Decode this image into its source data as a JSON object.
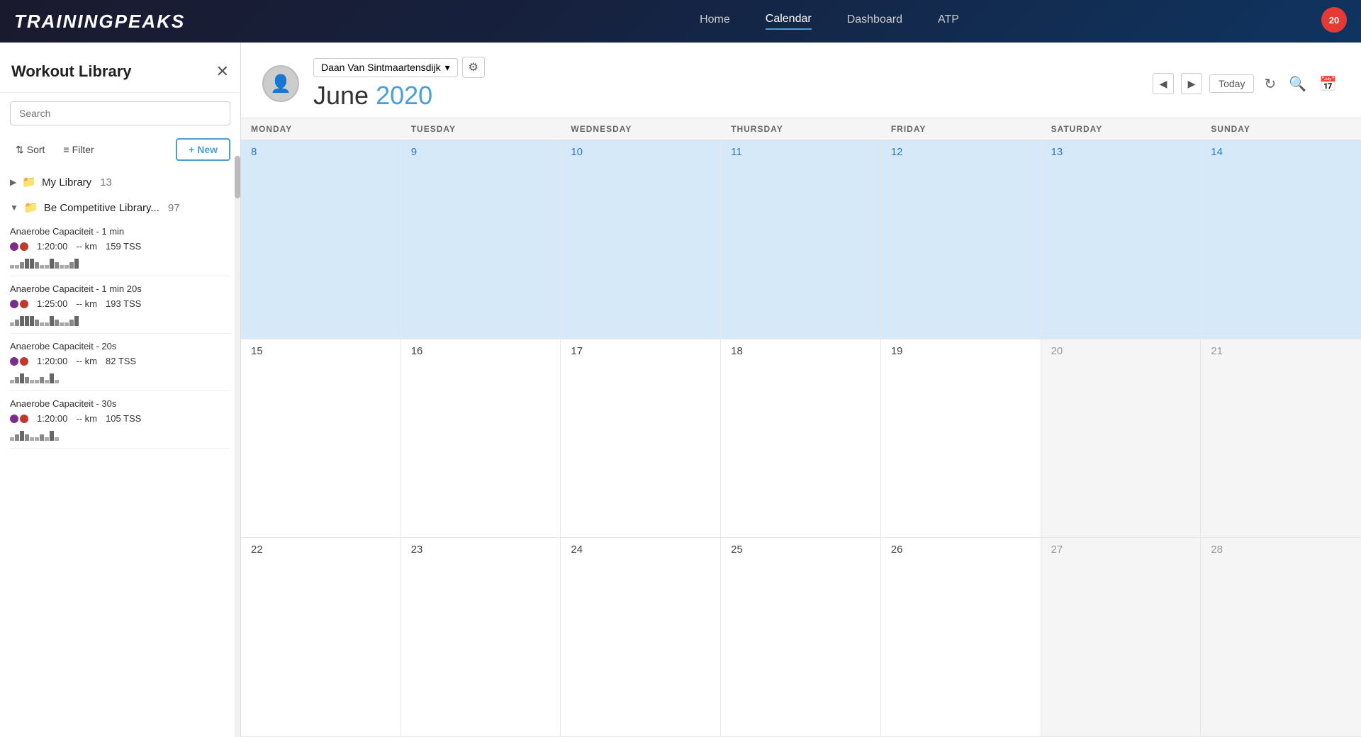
{
  "app": {
    "name": "TRAININGPEAKS",
    "notification_count": "20"
  },
  "nav": {
    "links": [
      "Home",
      "Calendar",
      "Dashboard",
      "ATP"
    ],
    "active": "Calendar"
  },
  "header": {
    "user": {
      "name": "Daan Van Sintmaartensdijk",
      "avatar_icon": "👤"
    },
    "month": "June",
    "year": "2020",
    "today_label": "Today",
    "prev_label": "◀",
    "next_label": "▶"
  },
  "calendar": {
    "days": [
      "MONDAY",
      "TUESDAY",
      "WEDNESDAY",
      "THURSDAY",
      "FRIDAY",
      "SATURDAY",
      "SUNDAY"
    ],
    "weeks": [
      {
        "cells": [
          {
            "date": "8",
            "highlight": true
          },
          {
            "date": "9",
            "highlight": true
          },
          {
            "date": "10",
            "highlight": true
          },
          {
            "date": "11",
            "highlight": true
          },
          {
            "date": "12",
            "highlight": true
          },
          {
            "date": "13",
            "highlight": true
          },
          {
            "date": "14",
            "highlight": true
          }
        ]
      },
      {
        "cells": [
          {
            "date": "15",
            "highlight": false
          },
          {
            "date": "16",
            "highlight": false
          },
          {
            "date": "17",
            "highlight": false
          },
          {
            "date": "18",
            "highlight": false
          },
          {
            "date": "19",
            "highlight": false
          },
          {
            "date": "20",
            "highlight": false
          },
          {
            "date": "21",
            "highlight": false
          }
        ]
      },
      {
        "cells": [
          {
            "date": "22",
            "highlight": false
          },
          {
            "date": "23",
            "highlight": false
          },
          {
            "date": "24",
            "highlight": false
          },
          {
            "date": "25",
            "highlight": false
          },
          {
            "date": "26",
            "highlight": false
          },
          {
            "date": "27",
            "highlight": false
          },
          {
            "date": "28",
            "highlight": false
          }
        ]
      }
    ]
  },
  "sidebar": {
    "title": "Workout Library",
    "search_placeholder": "Search",
    "sort_label": "Sort",
    "filter_label": "Filter",
    "new_label": "+ New",
    "libraries": [
      {
        "name": "My Library",
        "count": "13",
        "expanded": false,
        "arrow": "▶"
      },
      {
        "name": "Be Competitive Library...",
        "count": "97",
        "expanded": true,
        "arrow": "▼"
      }
    ],
    "workouts": [
      {
        "title": "Anaerobe Capaciteit - 1 min",
        "duration": "1:20:00",
        "distance": "-- km",
        "tss": "159 TSS",
        "bars": [
          "short",
          "med",
          "tall",
          "tall",
          "med",
          "short",
          "short",
          "med",
          "tall",
          "short",
          "short",
          "med",
          "tall",
          "short"
        ]
      },
      {
        "title": "Anaerobe Capaciteit - 1 min 20s",
        "duration": "1:25:00",
        "distance": "-- km",
        "tss": "193 TSS",
        "bars": [
          "short",
          "med",
          "tall",
          "tall",
          "med",
          "short",
          "short",
          "med",
          "tall",
          "short",
          "short",
          "med",
          "tall",
          "short"
        ]
      },
      {
        "title": "Anaerobe Capaciteit - 20s",
        "duration": "1:20:00",
        "distance": "-- km",
        "tss": "82 TSS",
        "bars": [
          "short",
          "med",
          "tall",
          "med",
          "short",
          "short",
          "med",
          "short",
          "tall",
          "short",
          "short",
          "med",
          "short",
          "short"
        ]
      },
      {
        "title": "Anaerobe Capaciteit - 30s",
        "duration": "1:20:00",
        "distance": "-- km",
        "tss": "105 TSS",
        "bars": [
          "short",
          "med",
          "tall",
          "med",
          "short",
          "short",
          "med",
          "short",
          "tall",
          "short",
          "short",
          "med",
          "short",
          "short"
        ]
      }
    ]
  }
}
